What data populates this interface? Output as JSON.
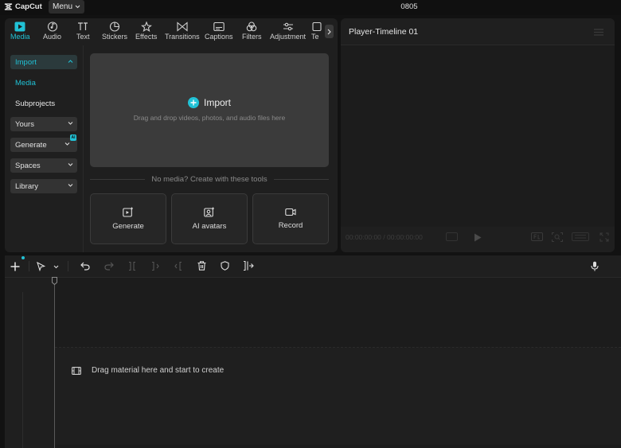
{
  "app": {
    "logo_text": "CapCut",
    "menu_label": "Menu",
    "project_name": "0805"
  },
  "media_toolbar": {
    "tabs": [
      {
        "label": "Media",
        "icon": "media-icon",
        "active": true
      },
      {
        "label": "Audio",
        "icon": "audio-icon"
      },
      {
        "label": "Text",
        "icon": "text-icon"
      },
      {
        "label": "Stickers",
        "icon": "stickers-icon"
      },
      {
        "label": "Effects",
        "icon": "effects-icon"
      },
      {
        "label": "Transitions",
        "icon": "transitions-icon"
      },
      {
        "label": "Captions",
        "icon": "captions-icon"
      },
      {
        "label": "Filters",
        "icon": "filters-icon"
      },
      {
        "label": "Adjustment",
        "icon": "adjustment-icon"
      },
      {
        "label": "Te",
        "icon": "template-icon"
      }
    ]
  },
  "sidebar": {
    "import_label": "Import",
    "media_label": "Media",
    "subprojects_label": "Subprojects",
    "yours_label": "Yours",
    "generate_label": "Generate",
    "ai_badge": "AI",
    "spaces_label": "Spaces",
    "library_label": "Library"
  },
  "import_area": {
    "title": "Import",
    "subtitle": "Drag and drop videos, photos, and audio files here"
  },
  "tools": {
    "heading": "No media? Create with these tools",
    "cards": [
      {
        "label": "Generate",
        "icon": "generate-icon"
      },
      {
        "label": "AI avatars",
        "icon": "ai-avatar-icon"
      },
      {
        "label": "Record",
        "icon": "record-icon"
      }
    ]
  },
  "player": {
    "title": "Player-Timeline 01",
    "timecode": "00:00:00:00 / 00:00:00:00"
  },
  "timeline": {
    "drag_hint": "Drag material here and start to create"
  },
  "colors": {
    "accent": "#21c2d6",
    "panel": "#1f1f1f",
    "background": "#121212"
  }
}
